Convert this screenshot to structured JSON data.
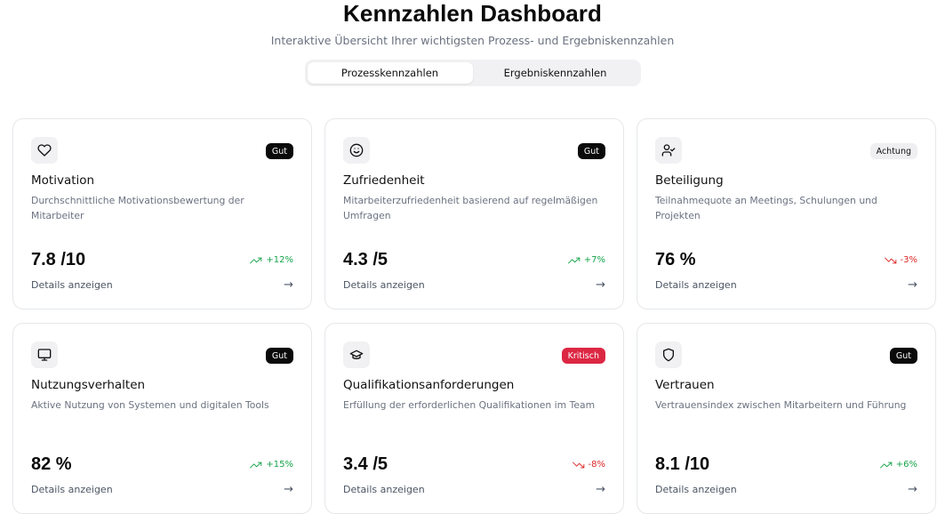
{
  "header": {
    "title": "Kennzahlen Dashboard",
    "subtitle": "Interaktive Übersicht Ihrer wichtigsten Prozess- und Ergebniskennzahlen"
  },
  "tabs": [
    {
      "label": "Prozesskennzahlen",
      "active": true
    },
    {
      "label": "Ergebniskennzahlen",
      "active": false
    }
  ],
  "colors": {
    "trend_up": "#16a34a",
    "trend_down": "#dc2626",
    "badge_gut": "#0a0a0a",
    "badge_kritisch": "#dc2743",
    "badge_achtung": "#efeff1"
  },
  "cards": [
    {
      "icon": "heart-icon",
      "badge": "Gut",
      "title": "Motivation",
      "description": "Durchschnittliche Motivationsbewertung der Mitarbeiter",
      "value": "7.8 /10",
      "trend": "+12%",
      "details": "Details anzeigen"
    },
    {
      "icon": "smile-icon",
      "badge": "Gut",
      "title": "Zufriedenheit",
      "description": "Mitarbeiterzufriedenheit basierend auf regelmäßigen Umfragen",
      "value": "4.3 /5",
      "trend": "+7%",
      "details": "Details anzeigen"
    },
    {
      "icon": "user-check-icon",
      "badge": "Achtung",
      "title": "Beteiligung",
      "description": "Teilnahmequote an Meetings, Schulungen und Projekten",
      "value": "76 %",
      "trend": "-3%",
      "details": "Details anzeigen"
    },
    {
      "icon": "monitor-icon",
      "badge": "Gut",
      "title": "Nutzungsverhalten",
      "description": "Aktive Nutzung von Systemen und digitalen Tools",
      "value": "82 %",
      "trend": "+15%",
      "details": "Details anzeigen"
    },
    {
      "icon": "graduation-cap-icon",
      "badge": "Kritisch",
      "title": "Qualifikationsanforderungen",
      "description": "Erfüllung der erforderlichen Qualifikationen im Team",
      "value": "3.4 /5",
      "trend": "-8%",
      "details": "Details anzeigen"
    },
    {
      "icon": "shield-icon",
      "badge": "Gut",
      "title": "Vertrauen",
      "description": "Vertrauensindex zwischen Mitarbeitern und Führung",
      "value": "8.1 /10",
      "trend": "+6%",
      "details": "Details anzeigen"
    }
  ]
}
